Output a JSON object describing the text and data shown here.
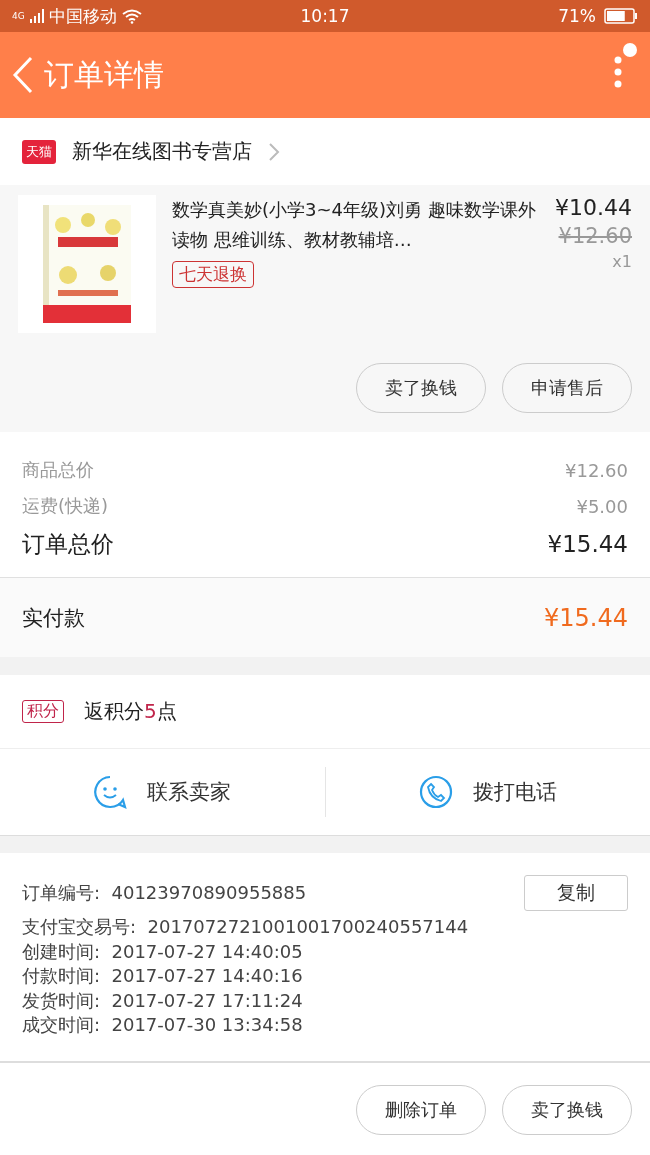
{
  "status_bar": {
    "network": "4G",
    "carrier": "中国移动",
    "time": "10:17",
    "battery_text": "71%",
    "battery": {
      "level": 0.71
    }
  },
  "header": {
    "title": "订单详情"
  },
  "store": {
    "badge": "天猫",
    "name": "新华在线图书专营店"
  },
  "product": {
    "title": "数学真美妙(小学3~4年级)刘勇 趣味数学课外读物 思维训练、教材教辅培…",
    "price": "¥10.44",
    "original_price": "¥12.60",
    "quantity": "x1",
    "tag": "七天退换",
    "kind": "picture",
    "actions": [
      "卖了换钱",
      "申请售后"
    ]
  },
  "summary": [
    {
      "label": "商品总价",
      "value": "¥12.60",
      "kind": "minor"
    },
    {
      "label": "运费(快递)",
      "value": "¥5.00",
      "kind": "minor"
    },
    {
      "label": "订单总价",
      "value": "¥15.44",
      "kind": "major"
    }
  ],
  "paid": {
    "label": "实付款",
    "value": "¥15.44"
  },
  "points": {
    "badge": "积分",
    "prefix": "返积分",
    "value": "5",
    "suffix": "点"
  },
  "contact": [
    {
      "label": "联系卖家",
      "kind": "chat"
    },
    {
      "label": "拨打电话",
      "kind": "phone"
    }
  ],
  "order_info": {
    "copy_button": "复制",
    "rows": [
      {
        "label": "订单编号:",
        "value": "40123970890955885"
      },
      {
        "label": "支付宝交易号:",
        "value": "2017072721001001700240557144"
      },
      {
        "label": "创建时间:",
        "value": "2017-07-27 14:40:05"
      },
      {
        "label": "付款时间:",
        "value": "2017-07-27 14:40:16"
      },
      {
        "label": "发货时间:",
        "value": "2017-07-27 17:11:24"
      },
      {
        "label": "成交时间:",
        "value": "2017-07-30 13:34:58"
      }
    ]
  },
  "footer_buttons": [
    "删除订单",
    "卖了换钱"
  ]
}
